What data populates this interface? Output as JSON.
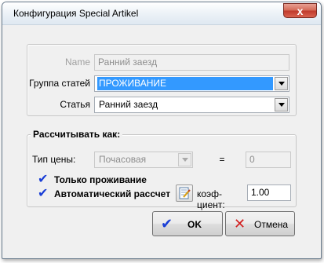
{
  "window": {
    "title": "Конфигурация Special Artikel",
    "close_glyph": "x"
  },
  "top_group": {
    "name_label": "Name",
    "name_value": "Ранний заезд",
    "group_label": "Группа статей",
    "group_value": "ПРОЖИВАНИЕ",
    "article_label": "Статья",
    "article_value": "Ранний заезд"
  },
  "calc_group": {
    "title": "Рассчитывать как:",
    "price_type_label": "Тип цены:",
    "price_type_value": "Почасовая",
    "equals": "=",
    "equals_value": "0",
    "only_stay_label": "Только проживание",
    "auto_calc_label": "Автоматический рассчет",
    "coef_label": "коэф-циент:",
    "coef_value": "1.00"
  },
  "buttons": {
    "ok": "OK",
    "cancel": "Отмена"
  },
  "colors": {
    "selection": "#3399ff",
    "check": "#1a3fd6",
    "cancel_x": "#d21f1f"
  }
}
